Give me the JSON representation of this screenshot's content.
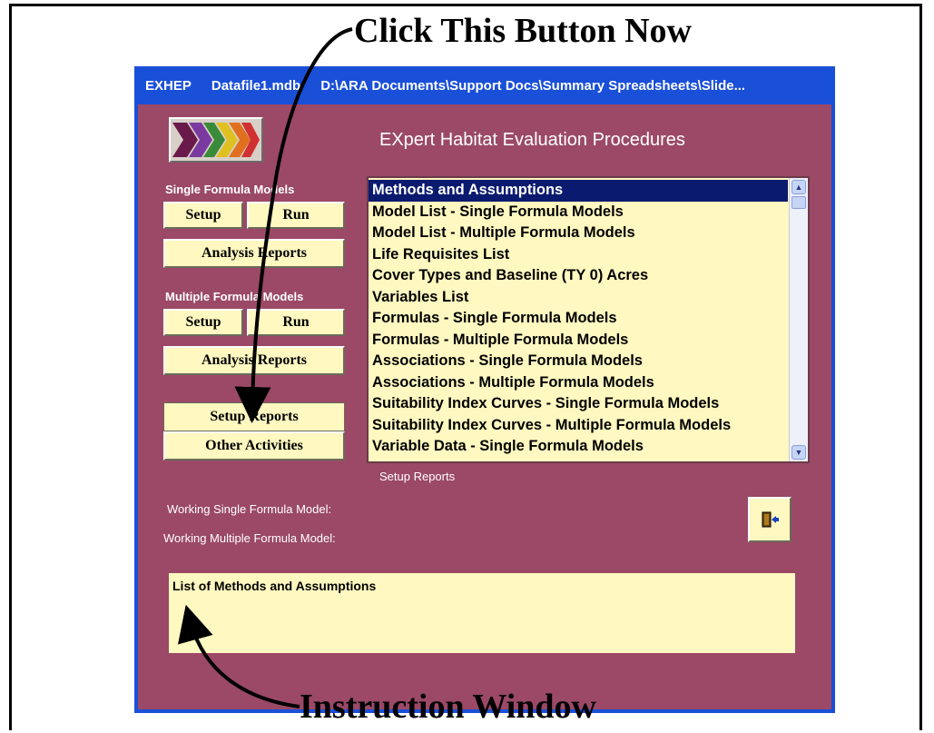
{
  "callouts": {
    "top": "Click This Button Now",
    "bottom": "Instruction Window"
  },
  "window": {
    "title_app": "EXHEP",
    "title_file": "Datafile1.mdb",
    "title_path": "D:\\ARA Documents\\Support Docs\\Summary Spreadsheets\\Slide..."
  },
  "app_title": "EXpert Habitat Evaluation Procedures",
  "single": {
    "label": "Single Formula Models",
    "setup": "Setup",
    "run": "Run",
    "reports": "Analysis Reports"
  },
  "multiple": {
    "label": "Multiple Formula Models",
    "setup": "Setup",
    "run": "Run",
    "reports": "Analysis Reports"
  },
  "setup_reports_button": "Setup Reports",
  "other_activities_button": "Other Activities",
  "report_list": {
    "items": [
      "Methods and Assumptions",
      "Model List - Single Formula Models",
      "Model List - Multiple Formula Models",
      "Life Requisites List",
      "Cover Types and Baseline (TY 0) Acres",
      "Variables List",
      "Formulas - Single Formula Models",
      "Formulas - Multiple Formula Models",
      "Associations - Single Formula Models",
      "Associations - Multiple Formula Models",
      "Suitability Index Curves - Single Formula Models",
      "Suitability Index Curves - Multiple Formula Models",
      "Variable Data - Single Formula Models"
    ],
    "selected_index": 0,
    "caption": "Setup Reports"
  },
  "working_single_label": "Working Single Formula Model:",
  "working_multiple_label": "Working Multiple Formula Model:",
  "exit_icon": "exit-door-icon",
  "instruction_text": "List of Methods and Assumptions",
  "colors": {
    "form_background": "#9b4966",
    "button_face": "#fff8c0",
    "title_bar": "#1a4fd8",
    "selection": "#0a1a6e"
  }
}
